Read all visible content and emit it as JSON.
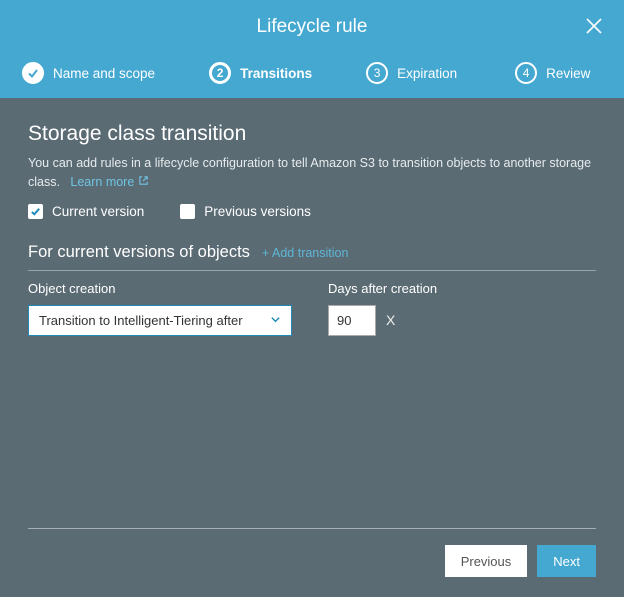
{
  "title": "Lifecycle rule",
  "steps": {
    "s1": "Name and scope",
    "s2_num": "2",
    "s2": "Transitions",
    "s3_num": "3",
    "s3": "Expiration",
    "s4_num": "4",
    "s4": "Review"
  },
  "section": {
    "title": "Storage class transition",
    "desc_a": "You can add rules in a lifecycle configuration to tell Amazon S3 to transition objects to another storage class.",
    "learn_more": "Learn more"
  },
  "checkboxes": {
    "current": "Current version",
    "previous": "Previous versions"
  },
  "subsection": {
    "title": "For current versions of objects",
    "add": "+ Add transition"
  },
  "columns": {
    "object_creation": "Object creation",
    "days_after": "Days after creation"
  },
  "transition_select": "Transition to Intelligent-Tiering after",
  "days_value": "90",
  "remove": "X",
  "buttons": {
    "previous": "Previous",
    "next": "Next"
  }
}
